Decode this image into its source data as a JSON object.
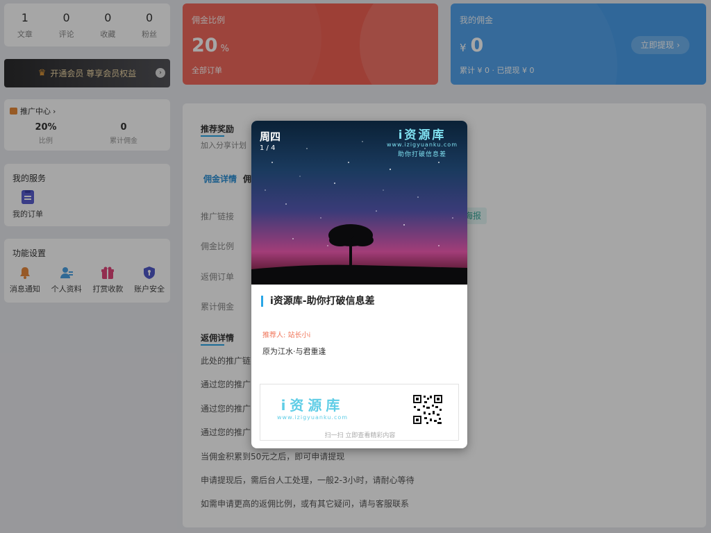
{
  "stats": [
    {
      "value": "1",
      "label": "文章"
    },
    {
      "value": "0",
      "label": "评论"
    },
    {
      "value": "0",
      "label": "收藏"
    },
    {
      "value": "0",
      "label": "粉丝"
    }
  ],
  "vip": {
    "label": "开通会员 尊享会员权益"
  },
  "promo": {
    "title": "推广中心",
    "ratio_value": "20%",
    "ratio_label": "比例",
    "total_value": "0",
    "total_label": "累计佣金"
  },
  "services": {
    "title": "我的服务",
    "items": [
      {
        "label": "我的订单",
        "icon": "clipboard-icon"
      }
    ]
  },
  "functions": {
    "title": "功能设置",
    "items": [
      {
        "label": "消息通知",
        "icon": "bell-icon"
      },
      {
        "label": "个人资料",
        "icon": "user-icon"
      },
      {
        "label": "打赏收款",
        "icon": "gift-icon"
      },
      {
        "label": "账户安全",
        "icon": "shield-icon"
      }
    ]
  },
  "commission_rate": {
    "title": "佣金比例",
    "value": "20",
    "unit": "%",
    "sub": "全部订单"
  },
  "my_commission": {
    "title": "我的佣金",
    "currency": "¥",
    "value": "0",
    "sub": "累计 ¥ 0  ·  已提现 ¥ 0",
    "button": "立即提现"
  },
  "rewards": {
    "title": "推荐奖励",
    "subtitle": "加入分享计划",
    "tab1": "佣金详情",
    "tab2": "佣",
    "rows": [
      "推广链接",
      "佣金比例",
      "返佣订单",
      "累计佣金"
    ],
    "poster_button": "海报",
    "detail_title": "返佣详情",
    "details": [
      "此处的推广链",
      "通过您的推广",
      "通过您的推广",
      "通过您的推广",
      "当佣金积累到50元之后，即可申请提现",
      "申请提现后，需后台人工处理，一般2-3小时，请耐心等待",
      "如需申请更高的返佣比例，或有其它疑问，请与客服联系"
    ]
  },
  "modal": {
    "day": "周四",
    "page": "1 / 4",
    "brand": "i资源库",
    "brand_url": "www.izigyuanku.com",
    "brand_slogan": "助你打破信息差",
    "title": "i资源库-助你打破信息差",
    "recommender": "推荐人: 站长小i",
    "quote": "原为江水·与君重逢",
    "footer_brand": "i资源库",
    "footer_url": "www.izigyuanku.com",
    "footer_hint": "扫一扫 立即查看精彩内容"
  },
  "colors": {
    "red_card": "#f26154",
    "blue_card": "#4a9fec",
    "accent": "#2aa6e6"
  }
}
